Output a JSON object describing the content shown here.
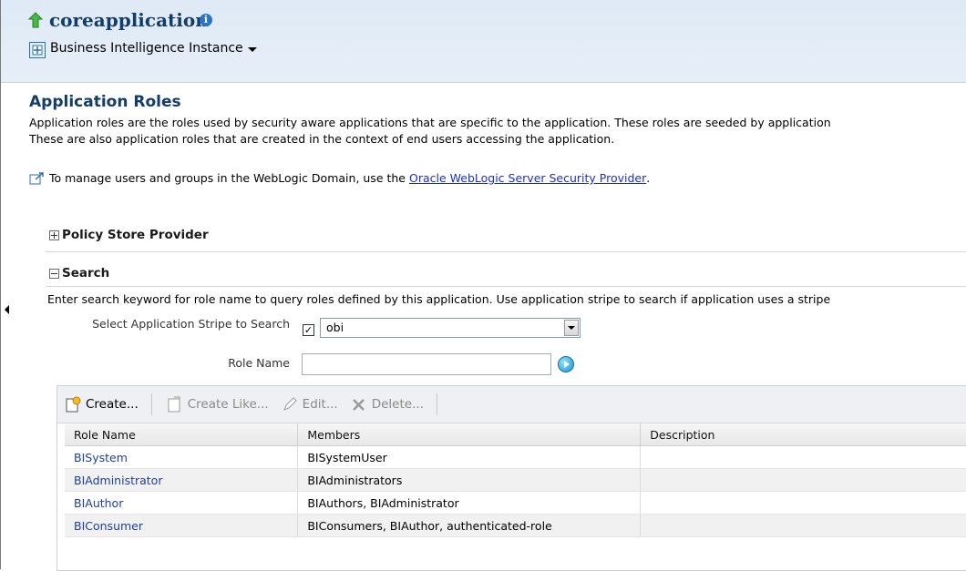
{
  "header": {
    "app_title": "coreapplication",
    "instance_menu": "Business Intelligence Instance"
  },
  "page": {
    "title": "Application Roles",
    "desc_line1": "Application roles are the roles used by security aware applications that are specific to the application. These roles are seeded by application",
    "desc_line2": "These are also application roles that are created in the context of end users accessing the application.",
    "manage_text": "To manage users and groups in the WebLogic Domain, use the",
    "manage_link": "Oracle WebLogic Server Security Provider",
    "manage_suffix": "."
  },
  "sections": {
    "policy_store": "Policy Store Provider",
    "search": "Search"
  },
  "search": {
    "help": "Enter search keyword for role name to query roles defined by this application. Use application stripe to search if application uses a stripe",
    "stripe_label": "Select Application Stripe to Search",
    "stripe_checked": true,
    "stripe_value": "obi",
    "role_name_label": "Role Name",
    "role_name_value": ""
  },
  "toolbar": {
    "create": "Create...",
    "create_like": "Create Like...",
    "edit": "Edit...",
    "delete": "Delete..."
  },
  "table": {
    "headers": [
      "Role Name",
      "Members",
      "Description"
    ],
    "rows": [
      {
        "role": "BISystem",
        "members": "BISystemUser",
        "description": ""
      },
      {
        "role": "BIAdministrator",
        "members": "BIAdministrators",
        "description": ""
      },
      {
        "role": "BIAuthor",
        "members": "BIAuthors, BIAdministrator",
        "description": ""
      },
      {
        "role": "BIConsumer",
        "members": "BIConsumers, BIAuthor, authenticated-role",
        "description": ""
      }
    ]
  },
  "colors": {
    "title_blue": "#123c69",
    "link_blue": "#1a2fd0",
    "header_bg": "#dfeaf6"
  }
}
